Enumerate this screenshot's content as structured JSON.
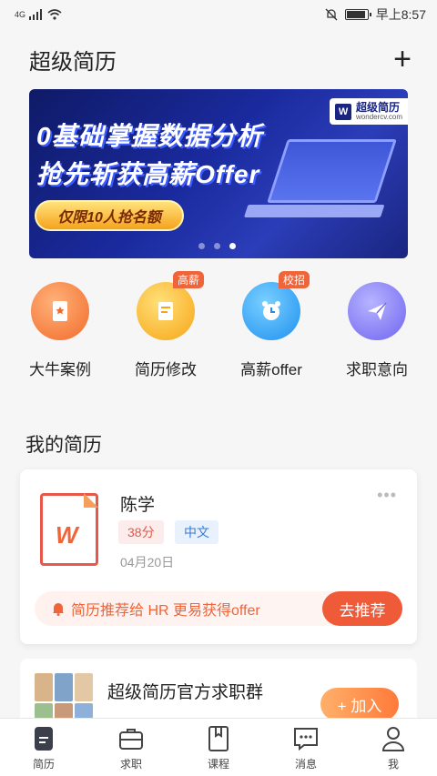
{
  "status_bar": {
    "network": "4G",
    "time": "早上8:57"
  },
  "header": {
    "title": "超级简历",
    "add_icon": "plus-icon"
  },
  "banner": {
    "headline1": "0基础掌握数据分析",
    "headline2": "抢先斩获高薪Offer",
    "cta": "仅限10人抢名额",
    "logo_name": "超级简历",
    "logo_url": "wondercv.com",
    "active_slide": 3,
    "slides": 3
  },
  "quick_nav": [
    {
      "label": "大牛案例",
      "icon": "bookmark-book-icon",
      "badge": ""
    },
    {
      "label": "简历修改",
      "icon": "document-edit-icon",
      "badge": "高薪"
    },
    {
      "label": "高薪offer",
      "icon": "alarm-clock-icon",
      "badge": "校招"
    },
    {
      "label": "求职意向",
      "icon": "paper-plane-icon",
      "badge": ""
    }
  ],
  "my_resumes": {
    "title": "我的简历",
    "card": {
      "name": "陈学",
      "score": "38分",
      "language": "中文",
      "date": "04月20日",
      "recommend_text": "简历推荐给 HR 更易获得offer",
      "recommend_button": "去推荐"
    }
  },
  "group": {
    "title": "超级简历官方求职群",
    "subtitle": "",
    "join_button": "+ 加入"
  },
  "tabs": [
    {
      "label": "简历",
      "icon": "resume-icon",
      "active": true
    },
    {
      "label": "求职",
      "icon": "briefcase-icon",
      "active": false
    },
    {
      "label": "课程",
      "icon": "book-icon",
      "active": false
    },
    {
      "label": "消息",
      "icon": "message-icon",
      "active": false
    },
    {
      "label": "我",
      "icon": "profile-icon",
      "active": false
    }
  ],
  "colors": {
    "accent": "#ef5a38",
    "banner_bg": "#1a2a9e"
  }
}
